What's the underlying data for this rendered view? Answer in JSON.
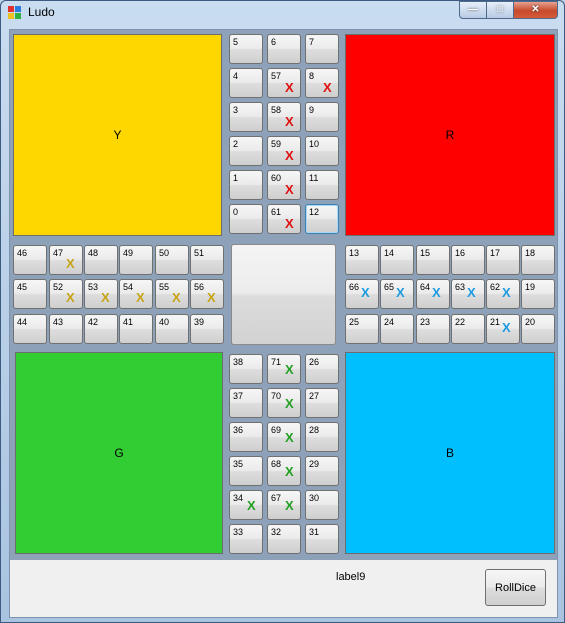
{
  "window": {
    "title": "Ludo"
  },
  "controls": {
    "minimize": "—",
    "maximize": "□",
    "close": "✕"
  },
  "colors": {
    "yellow": "#FFD700",
    "red": "#FF0000",
    "green": "#32CD32",
    "blue": "#00BFFF",
    "yellow_token": "#C8A415",
    "red_token": "#E01010",
    "green_token": "#22A022",
    "blue_token": "#1E9BE0"
  },
  "homes": {
    "yellow": "Y",
    "red": "R",
    "green": "G",
    "blue": "B"
  },
  "token_symbol": "X",
  "cells": [
    {
      "n": "5"
    },
    {
      "n": "6"
    },
    {
      "n": "7"
    },
    {
      "n": "4"
    },
    {
      "n": "57",
      "t": "red"
    },
    {
      "n": "8",
      "t": "red"
    },
    {
      "n": "3"
    },
    {
      "n": "58",
      "t": "red"
    },
    {
      "n": "9"
    },
    {
      "n": "2"
    },
    {
      "n": "59",
      "t": "red"
    },
    {
      "n": "10"
    },
    {
      "n": "1"
    },
    {
      "n": "60",
      "t": "red"
    },
    {
      "n": "11"
    },
    {
      "n": "0"
    },
    {
      "n": "61",
      "t": "red"
    },
    {
      "n": "12",
      "focus": true
    },
    {
      "n": "46"
    },
    {
      "n": "47",
      "t": "yellow"
    },
    {
      "n": "48"
    },
    {
      "n": "49"
    },
    {
      "n": "50"
    },
    {
      "n": "51"
    },
    {
      "n": "45"
    },
    {
      "n": "52",
      "t": "yellow"
    },
    {
      "n": "53",
      "t": "yellow"
    },
    {
      "n": "54",
      "t": "yellow"
    },
    {
      "n": "55",
      "t": "yellow"
    },
    {
      "n": "56",
      "t": "yellow"
    },
    {
      "n": "44"
    },
    {
      "n": "43"
    },
    {
      "n": "42"
    },
    {
      "n": "41"
    },
    {
      "n": "40"
    },
    {
      "n": "39"
    },
    {
      "n": "13"
    },
    {
      "n": "14"
    },
    {
      "n": "15"
    },
    {
      "n": "16"
    },
    {
      "n": "17"
    },
    {
      "n": "18"
    },
    {
      "n": "66",
      "t": "blue"
    },
    {
      "n": "65",
      "t": "blue"
    },
    {
      "n": "64",
      "t": "blue"
    },
    {
      "n": "63",
      "t": "blue"
    },
    {
      "n": "62",
      "t": "blue"
    },
    {
      "n": "19"
    },
    {
      "n": "25"
    },
    {
      "n": "24"
    },
    {
      "n": "23"
    },
    {
      "n": "22"
    },
    {
      "n": "21",
      "t": "blue"
    },
    {
      "n": "20"
    },
    {
      "n": "38"
    },
    {
      "n": "71",
      "t": "green"
    },
    {
      "n": "26"
    },
    {
      "n": "37"
    },
    {
      "n": "70",
      "t": "green"
    },
    {
      "n": "27"
    },
    {
      "n": "36"
    },
    {
      "n": "69",
      "t": "green"
    },
    {
      "n": "28"
    },
    {
      "n": "35"
    },
    {
      "n": "68",
      "t": "green"
    },
    {
      "n": "29"
    },
    {
      "n": "34",
      "t": "green"
    },
    {
      "n": "67",
      "t": "green"
    },
    {
      "n": "30"
    },
    {
      "n": "33"
    },
    {
      "n": "32"
    },
    {
      "n": "31"
    }
  ],
  "status_label": "label9",
  "roll_button": "RollDice"
}
